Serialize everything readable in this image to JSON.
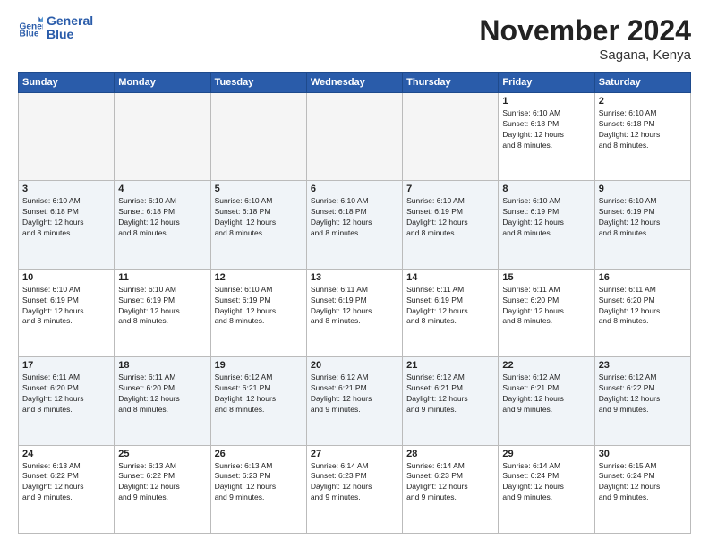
{
  "logo": {
    "line1": "General",
    "line2": "Blue"
  },
  "header": {
    "month": "November 2024",
    "location": "Sagana, Kenya"
  },
  "weekdays": [
    "Sunday",
    "Monday",
    "Tuesday",
    "Wednesday",
    "Thursday",
    "Friday",
    "Saturday"
  ],
  "weeks": [
    [
      {
        "day": "",
        "info": ""
      },
      {
        "day": "",
        "info": ""
      },
      {
        "day": "",
        "info": ""
      },
      {
        "day": "",
        "info": ""
      },
      {
        "day": "",
        "info": ""
      },
      {
        "day": "1",
        "info": "Sunrise: 6:10 AM\nSunset: 6:18 PM\nDaylight: 12 hours\nand 8 minutes."
      },
      {
        "day": "2",
        "info": "Sunrise: 6:10 AM\nSunset: 6:18 PM\nDaylight: 12 hours\nand 8 minutes."
      }
    ],
    [
      {
        "day": "3",
        "info": "Sunrise: 6:10 AM\nSunset: 6:18 PM\nDaylight: 12 hours\nand 8 minutes."
      },
      {
        "day": "4",
        "info": "Sunrise: 6:10 AM\nSunset: 6:18 PM\nDaylight: 12 hours\nand 8 minutes."
      },
      {
        "day": "5",
        "info": "Sunrise: 6:10 AM\nSunset: 6:18 PM\nDaylight: 12 hours\nand 8 minutes."
      },
      {
        "day": "6",
        "info": "Sunrise: 6:10 AM\nSunset: 6:18 PM\nDaylight: 12 hours\nand 8 minutes."
      },
      {
        "day": "7",
        "info": "Sunrise: 6:10 AM\nSunset: 6:19 PM\nDaylight: 12 hours\nand 8 minutes."
      },
      {
        "day": "8",
        "info": "Sunrise: 6:10 AM\nSunset: 6:19 PM\nDaylight: 12 hours\nand 8 minutes."
      },
      {
        "day": "9",
        "info": "Sunrise: 6:10 AM\nSunset: 6:19 PM\nDaylight: 12 hours\nand 8 minutes."
      }
    ],
    [
      {
        "day": "10",
        "info": "Sunrise: 6:10 AM\nSunset: 6:19 PM\nDaylight: 12 hours\nand 8 minutes."
      },
      {
        "day": "11",
        "info": "Sunrise: 6:10 AM\nSunset: 6:19 PM\nDaylight: 12 hours\nand 8 minutes."
      },
      {
        "day": "12",
        "info": "Sunrise: 6:10 AM\nSunset: 6:19 PM\nDaylight: 12 hours\nand 8 minutes."
      },
      {
        "day": "13",
        "info": "Sunrise: 6:11 AM\nSunset: 6:19 PM\nDaylight: 12 hours\nand 8 minutes."
      },
      {
        "day": "14",
        "info": "Sunrise: 6:11 AM\nSunset: 6:19 PM\nDaylight: 12 hours\nand 8 minutes."
      },
      {
        "day": "15",
        "info": "Sunrise: 6:11 AM\nSunset: 6:20 PM\nDaylight: 12 hours\nand 8 minutes."
      },
      {
        "day": "16",
        "info": "Sunrise: 6:11 AM\nSunset: 6:20 PM\nDaylight: 12 hours\nand 8 minutes."
      }
    ],
    [
      {
        "day": "17",
        "info": "Sunrise: 6:11 AM\nSunset: 6:20 PM\nDaylight: 12 hours\nand 8 minutes."
      },
      {
        "day": "18",
        "info": "Sunrise: 6:11 AM\nSunset: 6:20 PM\nDaylight: 12 hours\nand 8 minutes."
      },
      {
        "day": "19",
        "info": "Sunrise: 6:12 AM\nSunset: 6:21 PM\nDaylight: 12 hours\nand 8 minutes."
      },
      {
        "day": "20",
        "info": "Sunrise: 6:12 AM\nSunset: 6:21 PM\nDaylight: 12 hours\nand 9 minutes."
      },
      {
        "day": "21",
        "info": "Sunrise: 6:12 AM\nSunset: 6:21 PM\nDaylight: 12 hours\nand 9 minutes."
      },
      {
        "day": "22",
        "info": "Sunrise: 6:12 AM\nSunset: 6:21 PM\nDaylight: 12 hours\nand 9 minutes."
      },
      {
        "day": "23",
        "info": "Sunrise: 6:12 AM\nSunset: 6:22 PM\nDaylight: 12 hours\nand 9 minutes."
      }
    ],
    [
      {
        "day": "24",
        "info": "Sunrise: 6:13 AM\nSunset: 6:22 PM\nDaylight: 12 hours\nand 9 minutes."
      },
      {
        "day": "25",
        "info": "Sunrise: 6:13 AM\nSunset: 6:22 PM\nDaylight: 12 hours\nand 9 minutes."
      },
      {
        "day": "26",
        "info": "Sunrise: 6:13 AM\nSunset: 6:23 PM\nDaylight: 12 hours\nand 9 minutes."
      },
      {
        "day": "27",
        "info": "Sunrise: 6:14 AM\nSunset: 6:23 PM\nDaylight: 12 hours\nand 9 minutes."
      },
      {
        "day": "28",
        "info": "Sunrise: 6:14 AM\nSunset: 6:23 PM\nDaylight: 12 hours\nand 9 minutes."
      },
      {
        "day": "29",
        "info": "Sunrise: 6:14 AM\nSunset: 6:24 PM\nDaylight: 12 hours\nand 9 minutes."
      },
      {
        "day": "30",
        "info": "Sunrise: 6:15 AM\nSunset: 6:24 PM\nDaylight: 12 hours\nand 9 minutes."
      }
    ]
  ]
}
